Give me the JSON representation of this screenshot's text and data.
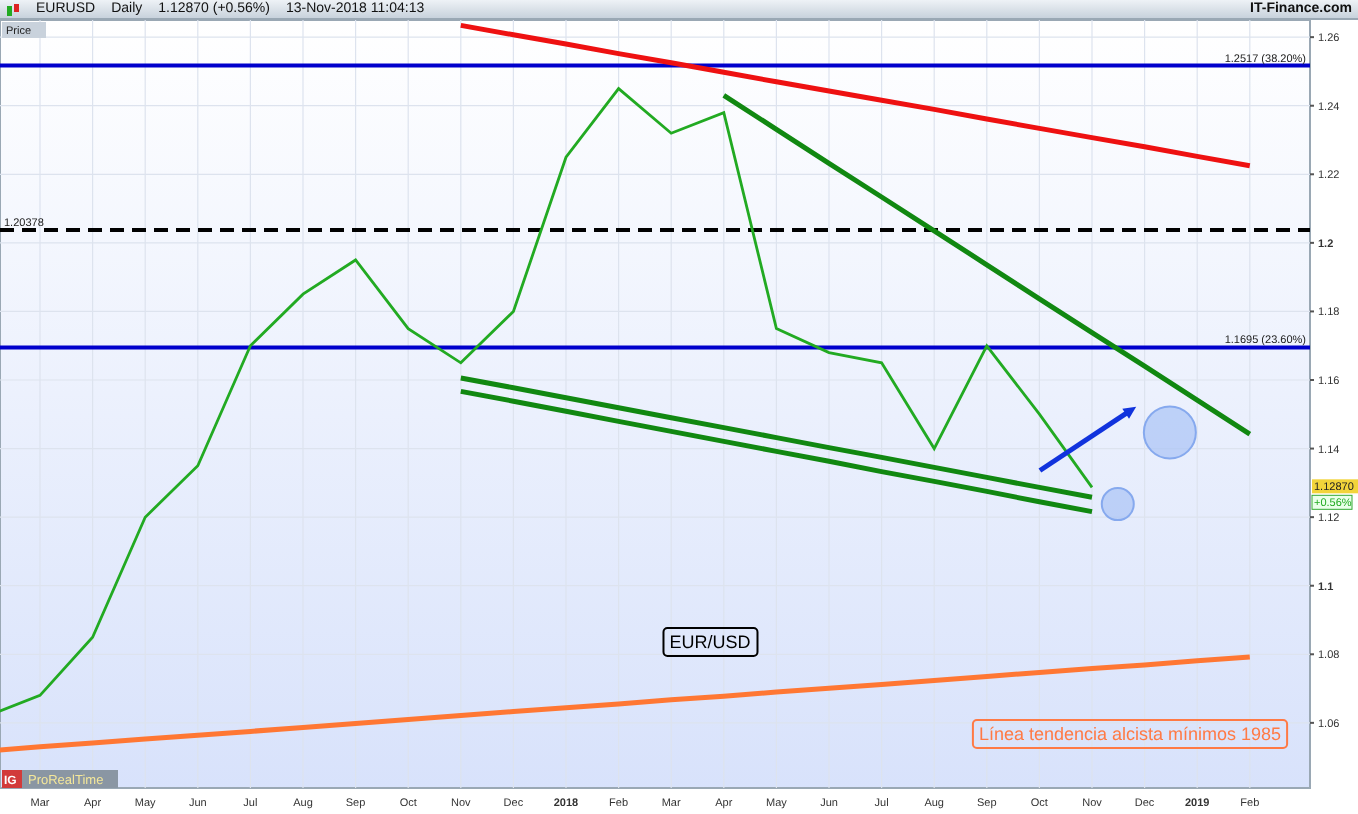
{
  "header": {
    "symbol": "EURUSD",
    "period": "Daily",
    "price": "1.12870",
    "change": "(+0.56%)",
    "timestamp": "13-Nov-2018 11:04:13",
    "site": "IT-Finance.com"
  },
  "price_tab": "Price",
  "chart": {
    "chart_data": {
      "type": "line",
      "grid": true,
      "ylim": [
        1.041,
        1.265
      ],
      "categories": [
        null,
        "Mar",
        "Apr",
        "May",
        "Jun",
        "Jul",
        "Aug",
        "Sep",
        "Oct",
        "Nov",
        "Dec",
        "2018",
        "Feb",
        "Mar",
        "Apr",
        "May",
        "Jun",
        "Jul",
        "Aug",
        "Sep",
        "Oct",
        "Nov",
        "Dec",
        "2019",
        "Feb"
      ],
      "yticks": [
        1.06,
        1.08,
        1.1,
        1.12,
        1.14,
        1.16,
        1.18,
        1.2,
        1.22,
        1.24,
        1.26
      ],
      "series": [
        {
          "color": "#22aa22",
          "values": [
            1.062,
            1.068,
            1.085,
            1.12,
            1.135,
            1.17,
            1.185,
            1.195,
            1.175,
            1.165,
            1.18,
            1.225,
            1.245,
            1.232,
            1.238,
            1.175,
            1.168,
            1.165,
            1.14,
            1.17,
            1.15,
            1.1287,
            null,
            null,
            null
          ]
        },
        {
          "color": "#ee1111",
          "values": [
            null,
            null,
            null,
            null,
            null,
            null,
            null,
            null,
            null,
            1.2634,
            1.2607,
            1.258,
            1.2552,
            1.2525,
            1.2498,
            1.247,
            1.2443,
            1.2416,
            1.2389,
            1.2361,
            1.2334,
            1.2307,
            1.228,
            1.2252,
            1.2225
          ]
        },
        {
          "color": "#118811",
          "values": [
            null,
            null,
            null,
            null,
            null,
            null,
            null,
            null,
            null,
            null,
            null,
            null,
            null,
            null,
            1.243,
            1.2331,
            1.2232,
            1.2134,
            1.2035,
            1.1936,
            1.1837,
            1.1738,
            1.164,
            1.1541,
            1.1442
          ]
        },
        {
          "color": "#118811",
          "values": [
            null,
            null,
            null,
            null,
            null,
            null,
            null,
            null,
            null,
            1.1606,
            1.1577,
            1.1548,
            1.1519,
            1.149,
            1.1461,
            1.1432,
            1.1403,
            1.1374,
            1.1345,
            1.1316,
            1.1287,
            1.1258,
            null,
            null,
            null
          ]
        },
        {
          "color": "#118811",
          "values": [
            null,
            null,
            null,
            null,
            null,
            null,
            null,
            null,
            null,
            1.1567,
            1.1538,
            1.1509,
            1.1479,
            1.145,
            1.1421,
            1.1392,
            1.1363,
            1.1333,
            1.1304,
            1.1275,
            1.1245,
            1.1216,
            null,
            null,
            null
          ]
        },
        {
          "color": "#ff7733",
          "values": [
            1.0518,
            1.053,
            1.0541,
            1.0553,
            1.0564,
            1.0575,
            1.0587,
            1.0598,
            1.061,
            1.0621,
            1.0633,
            1.0644,
            1.0655,
            1.0667,
            1.0678,
            1.069,
            1.0701,
            1.0712,
            1.0724,
            1.0735,
            1.0747,
            1.0758,
            1.0769,
            1.0781,
            1.0792
          ]
        }
      ],
      "ref_lines": [
        {
          "axis": "y",
          "value": 1.2517,
          "label": "1.2517 (38.20%)"
        },
        {
          "axis": "y",
          "value": 1.20378,
          "label": "1.20378"
        },
        {
          "axis": "y",
          "value": 1.1695,
          "label": "1.1695 (23.60%)"
        }
      ],
      "annotations": [
        "EUR/USD",
        "Línea tendencia alcista mínimos 1985"
      ]
    }
  },
  "price_tag": {
    "price": "1.12870",
    "change": "+0.56%"
  },
  "branding": {
    "logo": "IG",
    "name": "ProRealTime"
  }
}
